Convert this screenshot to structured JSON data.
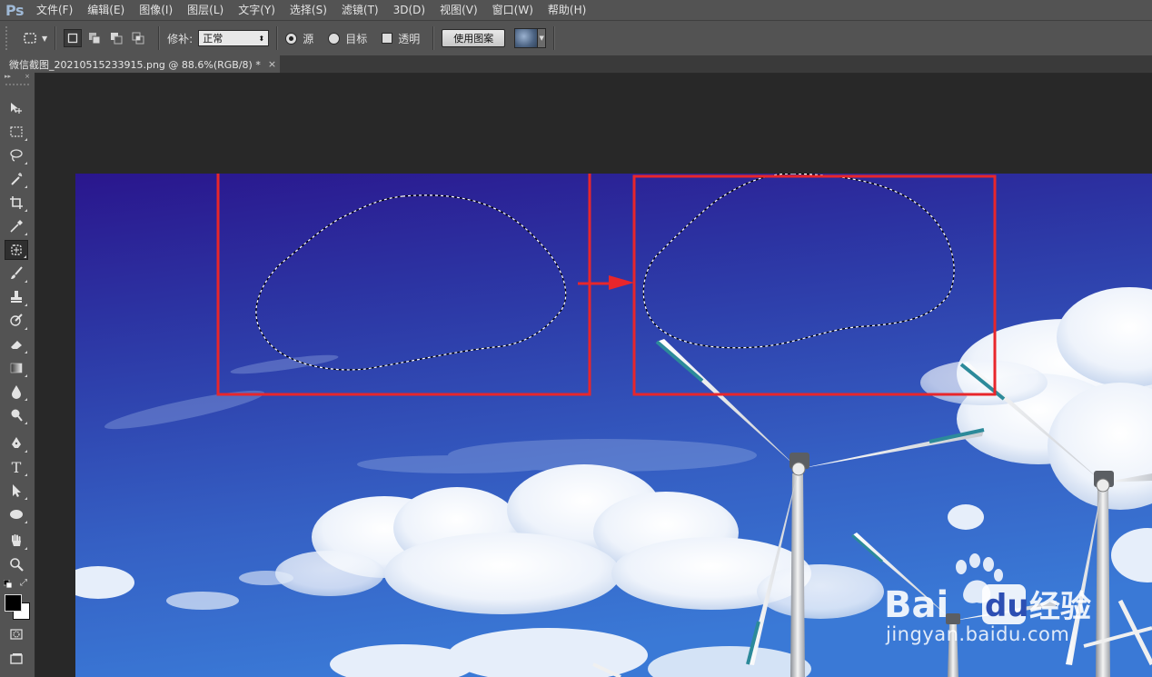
{
  "app": {
    "logo": "Ps"
  },
  "menu": {
    "items": [
      "文件(F)",
      "编辑(E)",
      "图像(I)",
      "图层(L)",
      "文字(Y)",
      "选择(S)",
      "滤镜(T)",
      "3D(D)",
      "视图(V)",
      "窗口(W)",
      "帮助(H)"
    ]
  },
  "options": {
    "patch_label": "修补:",
    "patch_mode": "正常",
    "source_label": "源",
    "target_label": "目标",
    "transparent_label": "透明",
    "use_pattern_label": "使用图案",
    "source_checked": true,
    "target_checked": false,
    "transparent_checked": false
  },
  "document": {
    "tab_title": "微信截图_20210515233915.png @ 88.6%(RGB/8) *",
    "close_glyph": "×"
  },
  "toolbar": {
    "head_expand": "▸▸",
    "head_close": "×",
    "tools": [
      "move-tool-icon",
      "marquee-tool-icon",
      "lasso-tool-icon",
      "magic-wand-tool-icon",
      "crop-tool-icon",
      "eyedropper-tool-icon",
      "patch-tool-icon",
      "brush-tool-icon",
      "clone-stamp-tool-icon",
      "history-brush-tool-icon",
      "eraser-tool-icon",
      "gradient-tool-icon",
      "blur-tool-icon",
      "dodge-tool-icon",
      "pen-tool-icon",
      "type-tool-icon",
      "path-selection-tool-icon",
      "ellipse-tool-icon",
      "hand-tool-icon",
      "zoom-tool-icon"
    ],
    "type_tool_glyph": "T",
    "active_tool": "patch-tool-icon",
    "foreground_color": "#000000",
    "background_color": "#ffffff"
  },
  "watermark": {
    "logo_text": "Bai",
    "logo_text_2": "du",
    "cn_text": "经验",
    "url_text": "jingyan.baidu.com"
  },
  "colors": {
    "annotation_red": "#e8262b",
    "sky_top": "#2c1b8f",
    "sky_bottom": "#3a6fd0"
  }
}
